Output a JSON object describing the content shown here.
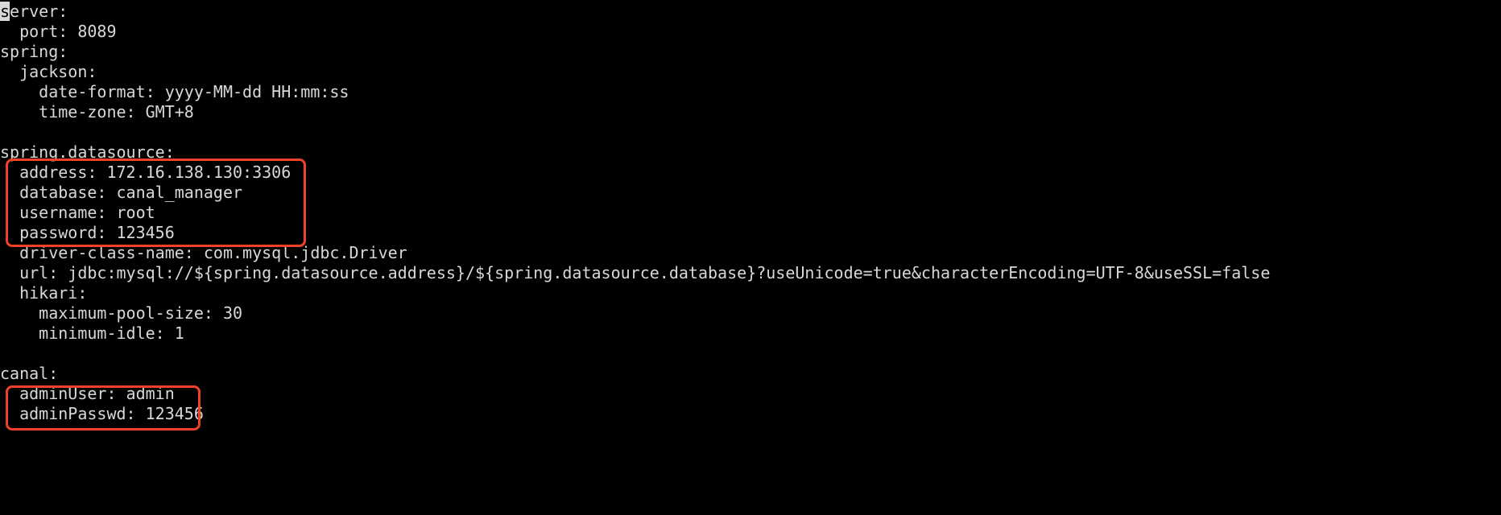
{
  "cursor_char": "s",
  "lines": {
    "l0_suffix": "erver:",
    "l1": "  port: 8089",
    "l2": "spring:",
    "l3": "  jackson:",
    "l4": "    date-format: yyyy-MM-dd HH:mm:ss",
    "l5": "    time-zone: GMT+8",
    "l6": "",
    "l7": "spring.datasource:",
    "l8": "  address: 172.16.138.130:3306",
    "l9": "  database: canal_manager",
    "l10": "  username: root",
    "l11": "  password: 123456",
    "l12": "  driver-class-name: com.mysql.jdbc.Driver",
    "l13": "  url: jdbc:mysql://${spring.datasource.address}/${spring.datasource.database}?useUnicode=true&characterEncoding=UTF-8&useSSL=false",
    "l14": "  hikari:",
    "l15": "    maximum-pool-size: 30",
    "l16": "    minimum-idle: 1",
    "l17": "",
    "l18": "canal:",
    "l19": "  adminUser: admin",
    "l20": "  adminPasswd: 123456"
  }
}
